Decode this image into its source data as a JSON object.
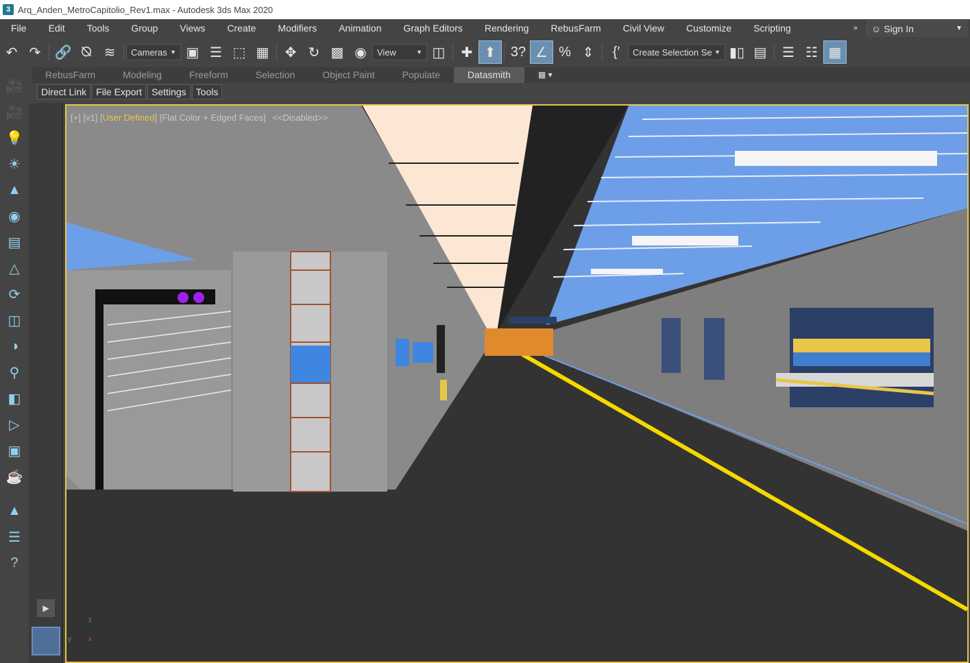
{
  "window": {
    "title": "Arq_Anden_MetroCapitolio_Rev1.max - Autodesk 3ds Max 2020"
  },
  "menu": {
    "items": [
      "File",
      "Edit",
      "Tools",
      "Group",
      "Views",
      "Create",
      "Modifiers",
      "Animation",
      "Graph Editors",
      "Rendering",
      "RebusFarm",
      "Civil View",
      "Customize",
      "Scripting"
    ],
    "more": "»",
    "sign_in": "Sign In"
  },
  "toolbar": {
    "cameras_dropdown": "Cameras",
    "view_dropdown": "View",
    "selection_set": "Create Selection Se",
    "active_color": "#6b8fb0"
  },
  "ribbon": {
    "tabs": [
      "RebusFarm",
      "Modeling",
      "Freeform",
      "Selection",
      "Object Paint",
      "Populate",
      "Datasmith"
    ],
    "active_tab": "Datasmith",
    "sub_buttons": [
      "Direct Link",
      "File Export",
      "Settings",
      "Tools"
    ]
  },
  "viewport": {
    "label_prefix": "[+] [v1] [",
    "label_user": "User Defined",
    "label_mid": "] [Flat Color + Edged Faces]",
    "label_disabled": "<<Disabled>>",
    "border_color": "#e8c64a"
  },
  "axis": {
    "y": "y",
    "z": "z",
    "x": "x"
  }
}
